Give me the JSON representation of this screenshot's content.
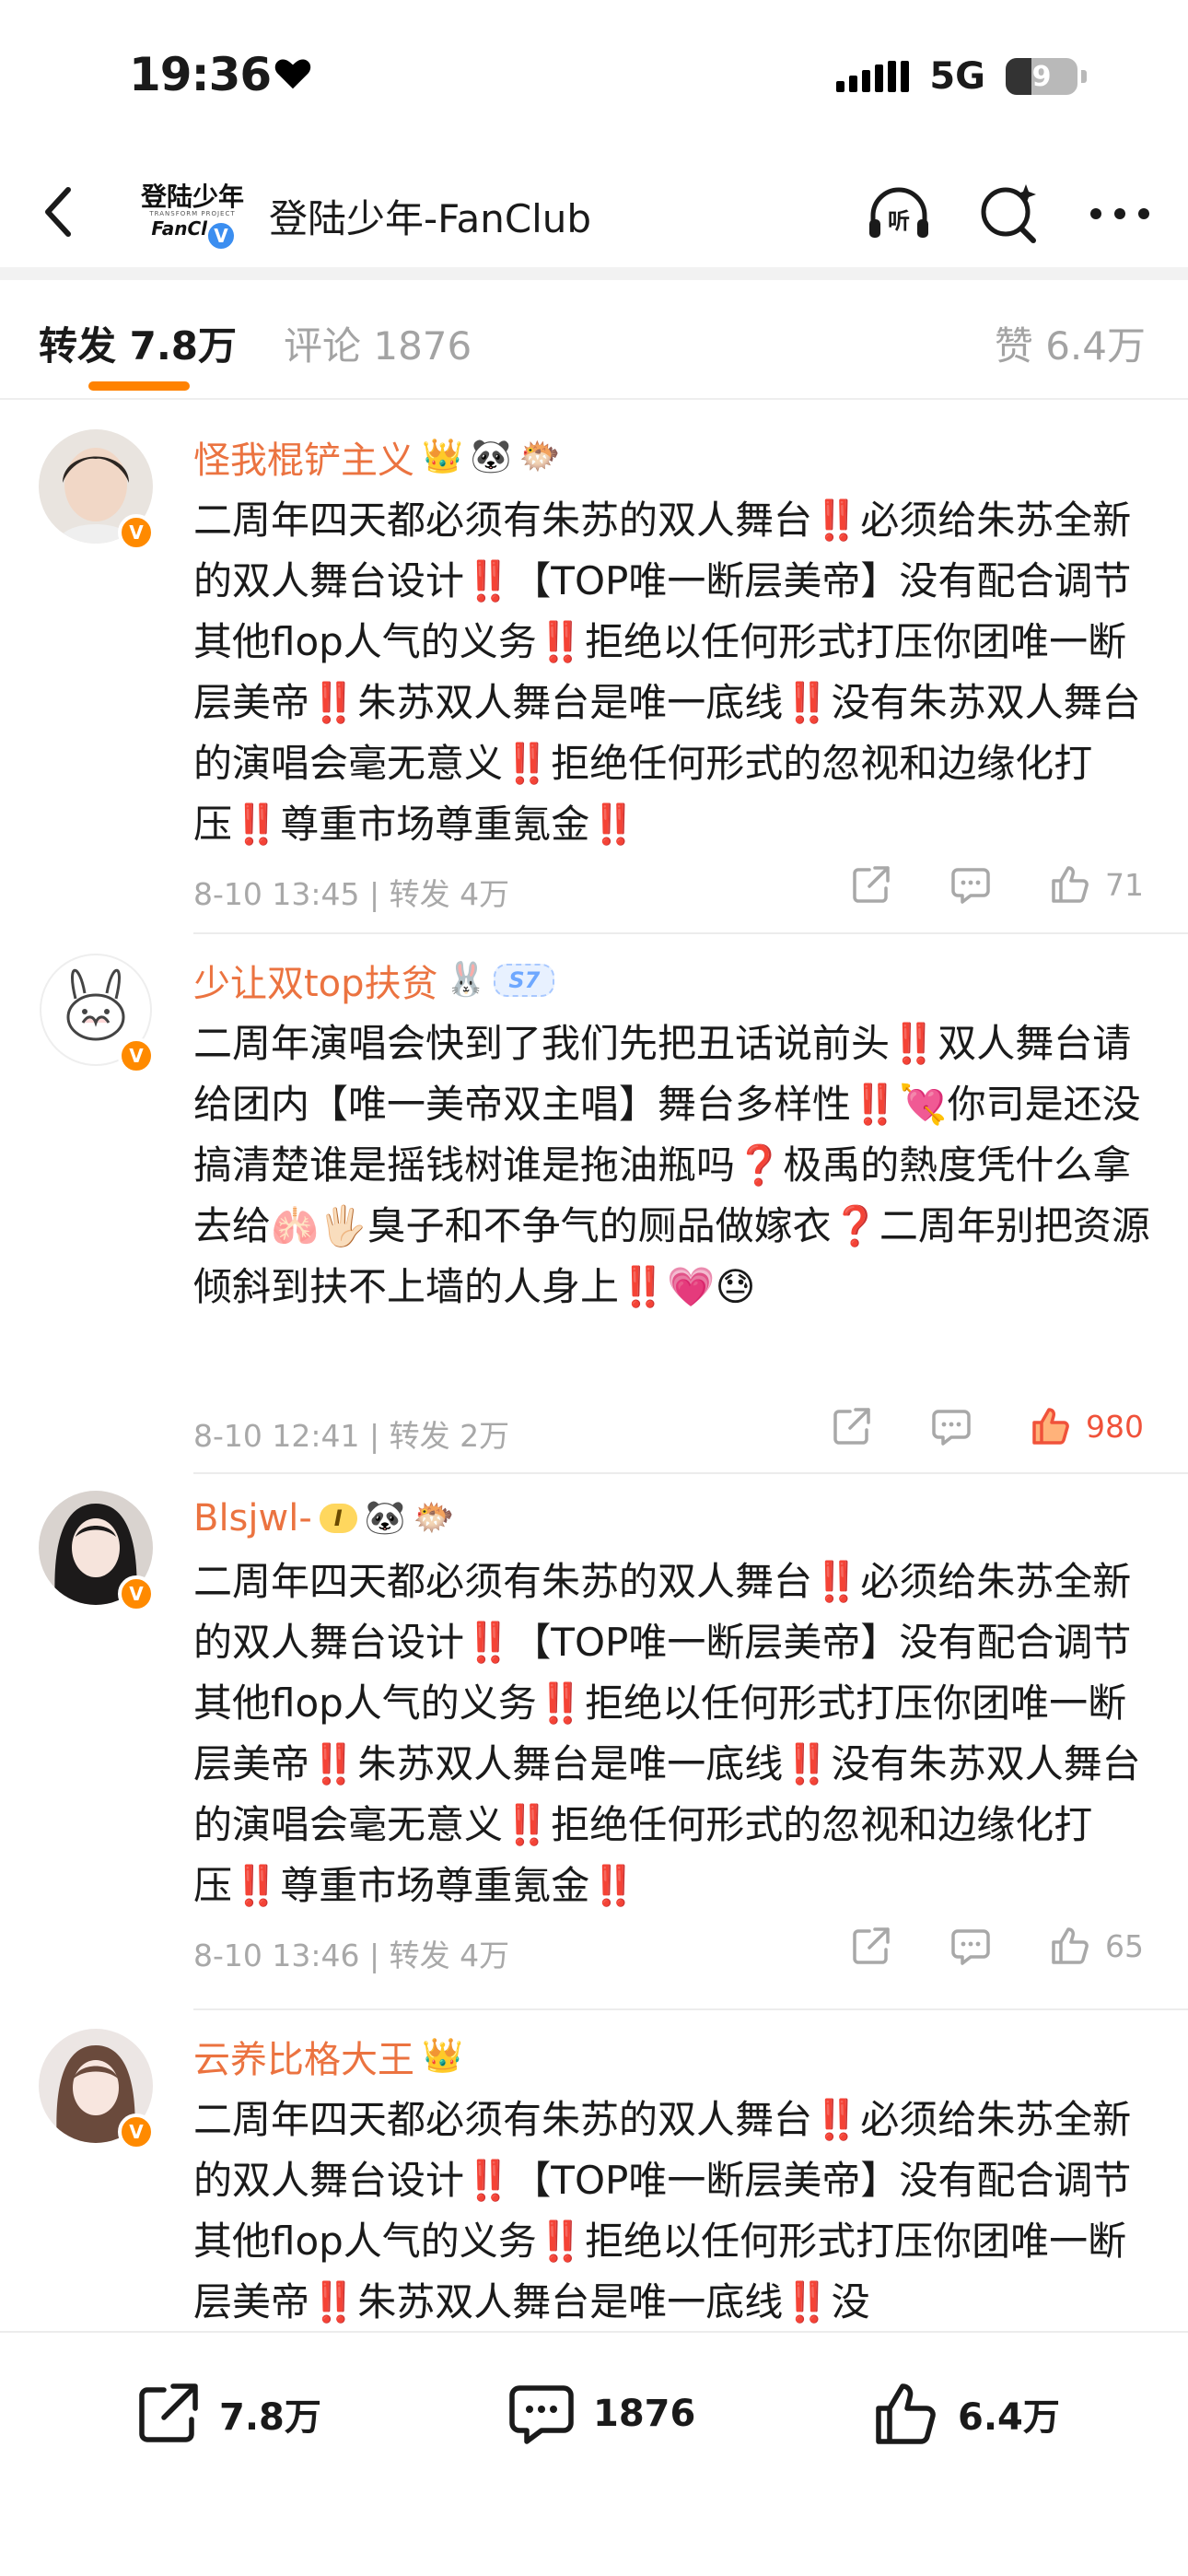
{
  "status": {
    "time": "19:36",
    "network": "5G",
    "battery": "9"
  },
  "nav": {
    "avatar_line1": "登陆少年",
    "avatar_line2": "TRANSFORM PROJECT",
    "avatar_line3": "FanClub",
    "verify_mark": "V",
    "title": "登陆少年-FanClub",
    "icons": [
      "back-arrow-icon",
      "listen-icon",
      "ai-search-icon",
      "more-dots-icon"
    ],
    "listen_label": "听"
  },
  "tabs": {
    "repost": "转发 7.8万",
    "comment": "评论 1876",
    "like": "赞 6.4万"
  },
  "posts": [
    {
      "username": "怪我棍铲主义",
      "badges": [
        "👑",
        "🐼",
        "🐡"
      ],
      "content": "二周年四天都必须有朱苏的双人舞台‼️必须给朱苏全新的双人舞台设计‼️【TOP唯一断层美帝】没有配合调节其他flop人气的义务‼️拒绝以任何形式打压你团唯一断层美帝‼️朱苏双人舞台是唯一底线‼️没有朱苏双人舞台的演唱会毫无意义‼️拒绝任何形式的忽视和边缘化打压‼️尊重市场尊重氪金‼️",
      "meta": "8-10 13:45 | 转发 4万",
      "likes": "71",
      "hot": false
    },
    {
      "username": "少让双top扶贫",
      "badges": [
        "🐰"
      ],
      "tag": "S7",
      "content": "二周年演唱会快到了我们先把丑话说前头‼️双人舞台请给团内【唯一美帝双主唱】舞台多样性‼️💘你司是还没搞清楚谁是摇钱树谁是拖油瓶吗❓极禹的熱度凭什么拿去给🫁🖐🏻臭子和不争气的厕品做嫁衣❓二周年别把资源倾斜到扶不上墙的人身上‼️💗😓",
      "meta": "8-10 12:41 | 转发 2万",
      "likes": "980",
      "hot": true
    },
    {
      "username": "Blsjwl-",
      "badges": [
        "🐼",
        "🐡"
      ],
      "tag": "I",
      "content": "二周年四天都必须有朱苏的双人舞台‼️必须给朱苏全新的双人舞台设计‼️【TOP唯一断层美帝】没有配合调节其他flop人气的义务‼️拒绝以任何形式打压你团唯一断层美帝‼️朱苏双人舞台是唯一底线‼️没有朱苏双人舞台的演唱会毫无意义‼️拒绝任何形式的忽视和边缘化打压‼️尊重市场尊重氪金‼️",
      "meta": "8-10 13:46 | 转发 4万",
      "likes": "65",
      "hot": false
    },
    {
      "username": "云养比格大王",
      "badges": [
        "👑"
      ],
      "content": "二周年四天都必须有朱苏的双人舞台‼️必须给朱苏全新的双人舞台设计‼️【TOP唯一断层美帝】没有配合调节其他flop人气的义务‼️拒绝以任何形式打压你团唯一断层美帝‼️朱苏双人舞台是唯一底线‼️没",
      "meta": "",
      "likes": "",
      "hot": false
    }
  ],
  "bottom_bar": {
    "repost": "7.8万",
    "comment": "1876",
    "like": "6.4万"
  },
  "colors": {
    "accent": "#ff8200",
    "username": "#eb7340",
    "hot_like": "#f0523a",
    "meta": "#a8a8a8",
    "verify_blue": "#3b8ef0",
    "verify_orange": "#ff8a00"
  }
}
